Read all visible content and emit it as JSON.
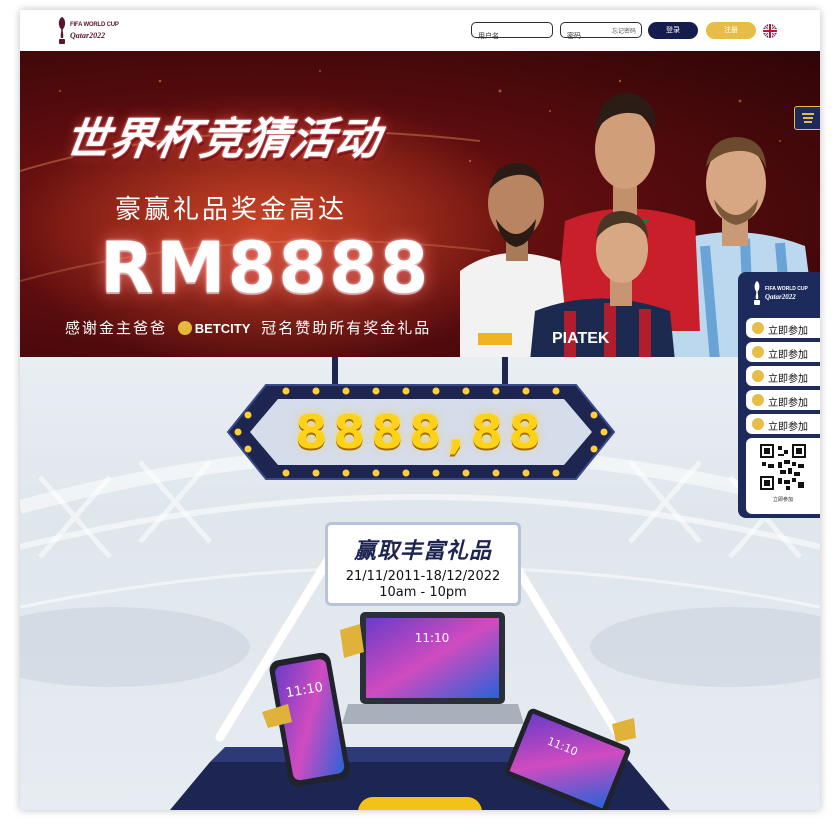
{
  "header": {
    "logo_line1": "FIFA WORLD CUP",
    "logo_line2": "Qatar2022",
    "username_placeholder": "用户名",
    "password_placeholder": "密码",
    "forgot_label": "忘记密码",
    "login_label": "登录",
    "register_label": "注册",
    "language_icon": "uk-flag-icon"
  },
  "hero": {
    "title": "世界杯竞猜活动",
    "subtitle": "豪赢礼品奖金高达",
    "amount": "RM8888",
    "sponsor_prefix": "感谢金主爸爸",
    "sponsor_brand": "BETCITY",
    "sponsor_suffix": "冠名赞助所有奖金礼品",
    "player_shirt_text": "PIATEK"
  },
  "jackpot": {
    "value": "8888,88"
  },
  "event": {
    "title": "赢取丰富礼品",
    "dates": "21/11/2011-18/12/2022",
    "time": "10am - 10pm"
  },
  "devices": {
    "laptop_time": "11:10",
    "phone_time": "11:10",
    "tablet_time": "11:10"
  },
  "side_panel": {
    "logo_line1": "FIFA WORLD CUP",
    "logo_line2": "Qatar2022",
    "items": [
      {
        "label": "立即参加"
      },
      {
        "label": "立即参加"
      },
      {
        "label": "立即参加"
      },
      {
        "label": "立即参加"
      },
      {
        "label": "立即参加"
      }
    ],
    "qr_caption": "立即参加"
  },
  "colors": {
    "navy": "#151d4e",
    "gold": "#e8bd47",
    "hero_red": "#6a0f10",
    "jackpot_yellow": "#ffd21a"
  }
}
